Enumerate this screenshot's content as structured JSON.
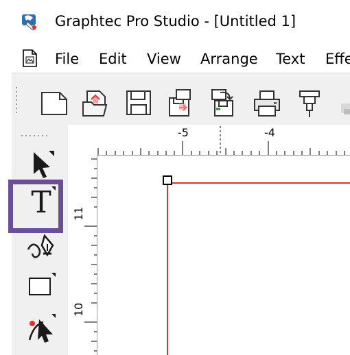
{
  "window": {
    "title": "Graphtec Pro Studio - [Untitled 1]"
  },
  "menu": {
    "items": [
      "File",
      "Edit",
      "View",
      "Arrange",
      "Text",
      "Effe"
    ]
  },
  "toolbar": {
    "buttons": [
      "new-document-icon",
      "open-icon",
      "save-icon",
      "save-as-icon",
      "save-send-icon",
      "print-icon",
      "cutter-icon"
    ]
  },
  "palette": {
    "tools": [
      "select-arrow-icon",
      "text-tool-icon",
      "pen-tool-icon",
      "rectangle-tool-icon",
      "node-edit-tool-icon"
    ],
    "highlighted_tool": "text-tool-icon",
    "highlight_color": "#6a4e96"
  },
  "rulers": {
    "horizontal_labels": [
      "-5",
      "-4"
    ],
    "vertical_labels": [
      "11",
      "10"
    ]
  },
  "canvas": {
    "page_border_color": "#e03030"
  }
}
